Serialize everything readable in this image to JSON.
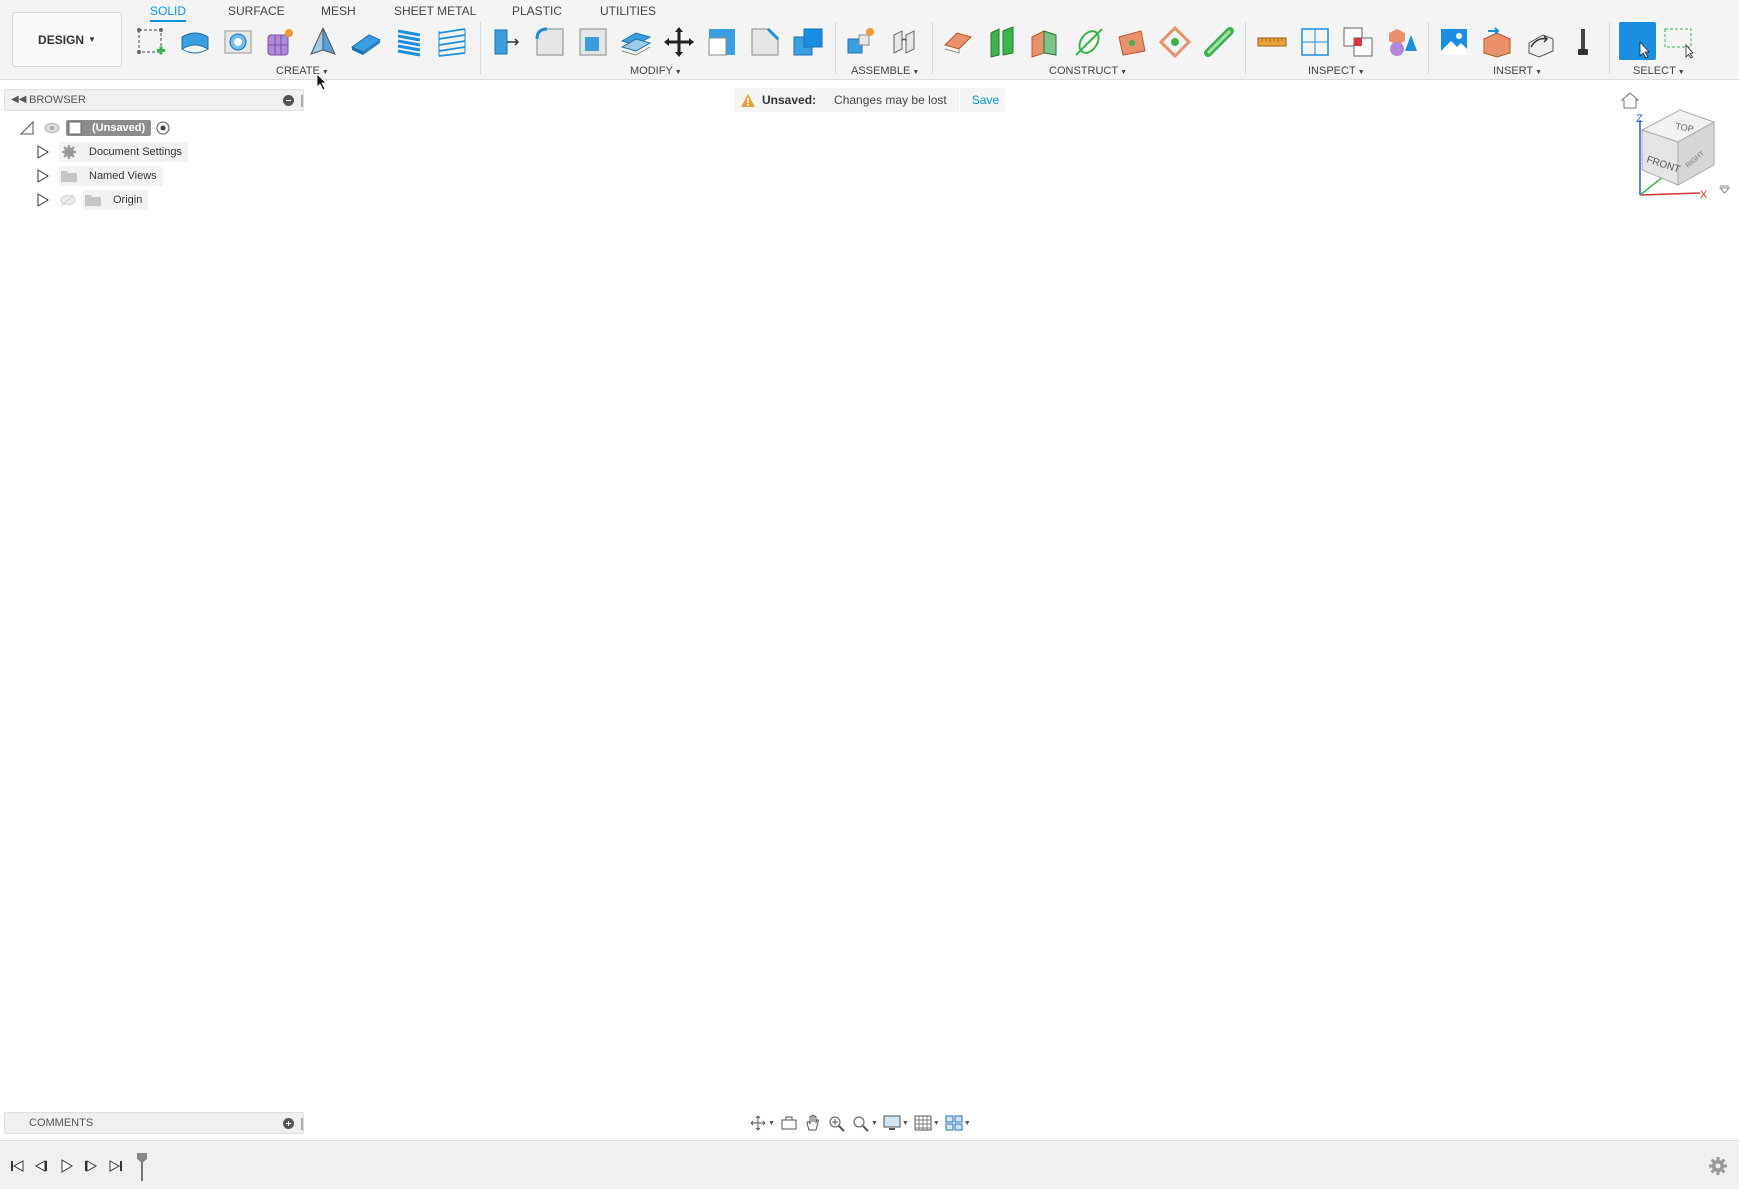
{
  "workspace": {
    "label": "DESIGN"
  },
  "tabs": [
    {
      "label": "SOLID",
      "active": true
    },
    {
      "label": "SURFACE"
    },
    {
      "label": "MESH"
    },
    {
      "label": "SHEET METAL"
    },
    {
      "label": "PLASTIC"
    },
    {
      "label": "UTILITIES"
    }
  ],
  "groups": {
    "create": "CREATE",
    "modify": "MODIFY",
    "assemble": "ASSEMBLE",
    "construct": "CONSTRUCT",
    "inspect": "INSPECT",
    "insert": "INSERT",
    "select": "SELECT"
  },
  "browser": {
    "title": "BROWSER",
    "root_label": "(Unsaved)",
    "items": [
      {
        "label": "Document Settings",
        "icon": "gear-icon"
      },
      {
        "label": "Named Views",
        "icon": "folder-icon"
      },
      {
        "label": "Origin",
        "icon": "folder-icon"
      }
    ]
  },
  "banner": {
    "title": "Unsaved:",
    "message": "Changes may be lost",
    "save_label": "Save"
  },
  "comments": {
    "title": "COMMENTS"
  },
  "viewcube": {
    "top": "TOP",
    "front": "FRONT",
    "right": "RIGHT",
    "axis_z": "Z",
    "axis_x": "X"
  },
  "colors": {
    "accent": "#0696d7",
    "select_active": "#1a8ee0",
    "toolbar_bg": "#f4f4f4"
  }
}
